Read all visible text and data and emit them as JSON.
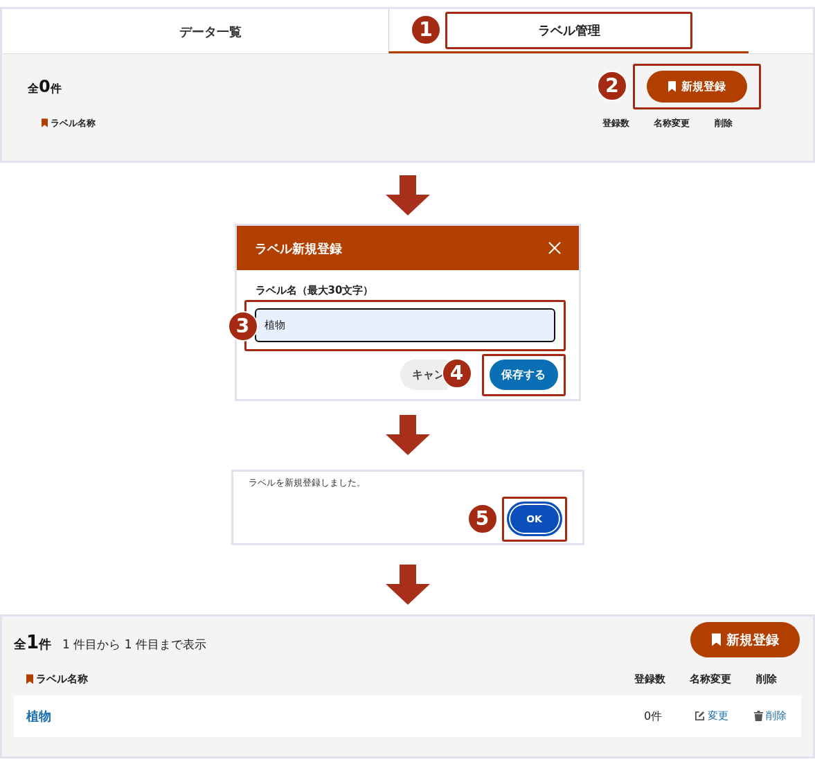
{
  "panel_before": {
    "tabs": [
      {
        "label": "データ一覧",
        "selected": false
      },
      {
        "label": "ラベル管理",
        "selected": true,
        "step": "1"
      }
    ],
    "total": {
      "prefix": "全",
      "count": "0",
      "suffix": "件"
    },
    "new_button": {
      "label": "新規登録",
      "step": "2"
    },
    "columns": [
      "ラベル名称",
      "登録数",
      "名称変更",
      "削除"
    ]
  },
  "dialog": {
    "title": "ラベル新規登録",
    "field_label": "ラベル名（最大30文字）",
    "value": "植物",
    "field_step": "3",
    "cancel": "キャン",
    "save": "保存する",
    "save_step": "4"
  },
  "alert": {
    "message": "ラベルを新規登録しました。",
    "ok": "OK",
    "ok_step": "5"
  },
  "panel_after": {
    "total": {
      "prefix": "全",
      "count": "1",
      "suffix": "件"
    },
    "range": "1 件目から 1 件目まで表示",
    "new_button": {
      "label": "新規登録"
    },
    "columns": [
      "ラベル名称",
      "登録数",
      "名称変更",
      "削除"
    ],
    "rows": [
      {
        "name": "植物",
        "count": "0件",
        "rename": "変更",
        "delete": "削除"
      }
    ]
  }
}
